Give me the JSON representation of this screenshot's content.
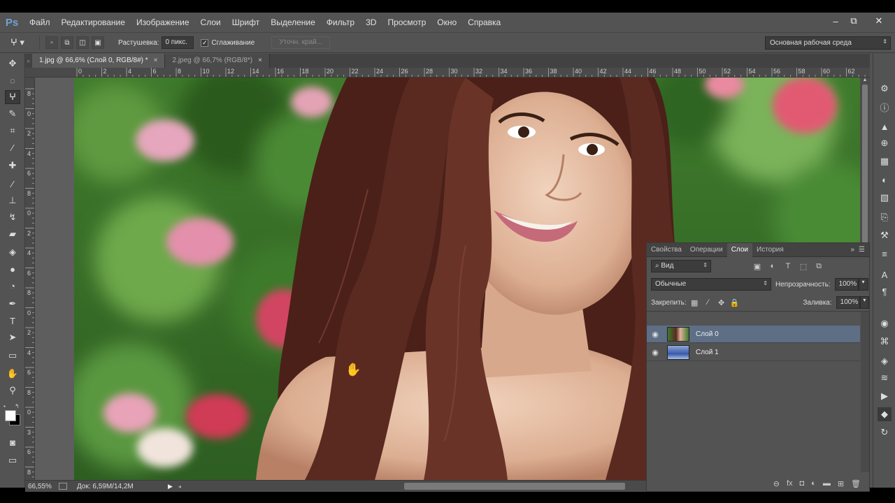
{
  "app": {
    "logo": "Ps"
  },
  "menu": [
    "Файл",
    "Редактирование",
    "Изображение",
    "Слои",
    "Шрифт",
    "Выделение",
    "Фильтр",
    "3D",
    "Просмотр",
    "Окно",
    "Справка"
  ],
  "window_controls": {
    "minimize": "–",
    "restore": "⧉",
    "close": "✕"
  },
  "options": {
    "feather_label": "Растушевка:",
    "feather_value": "0 пикс.",
    "antialias_label": "Сглаживание",
    "refine_label": "Уточн. край...",
    "workspace": "Основная рабочая среда"
  },
  "tabs": [
    {
      "label": "1.jpg @ 66,6% (Слой 0, RGB/8#) *",
      "close": "×"
    },
    {
      "label": "2.jpeg @ 66,7% (RGB/8*)",
      "close": "×"
    }
  ],
  "ruler_h": [
    "0",
    "2",
    "4",
    "6",
    "8",
    "10",
    "12",
    "14",
    "16",
    "18",
    "20",
    "22",
    "24",
    "26",
    "28",
    "30",
    "32",
    "34",
    "36",
    "38",
    "40",
    "42",
    "44",
    "46",
    "48",
    "50",
    "52",
    "54",
    "56",
    "58",
    "60",
    "62"
  ],
  "ruler_v": [
    "8",
    "0",
    "2",
    "4",
    "6",
    "8",
    "0",
    "2",
    "4",
    "6",
    "8",
    "0",
    "2",
    "4",
    "6",
    "8",
    "0",
    "3",
    "6",
    "8"
  ],
  "status": {
    "zoom": "66,55%",
    "doc": "Док: 6,59M/14,2M"
  },
  "panel": {
    "tabs": [
      "Свойства",
      "Операции",
      "Слои",
      "История"
    ],
    "kind_filter": "Вид",
    "blend_mode": "Обычные",
    "opacity_label": "Непрозрачность:",
    "opacity_value": "100%",
    "lock_label": "Закрепить:",
    "fill_label": "Заливка:",
    "fill_value": "100%",
    "layers": [
      {
        "name": "Слой 0",
        "selected": true
      },
      {
        "name": "Слой 1",
        "selected": false
      }
    ]
  },
  "colors": {
    "selection": "#5d6e85",
    "ps_blue": "#6fa4d4",
    "panel_bg": "#535353"
  }
}
